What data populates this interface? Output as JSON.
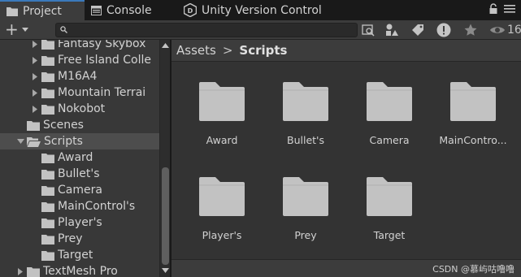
{
  "tabs": [
    {
      "label": "Project",
      "icon": "folder-icon",
      "active": true
    },
    {
      "label": "Console",
      "icon": "console-icon",
      "active": false
    },
    {
      "label": "Unity Version Control",
      "icon": "unity-vc-icon",
      "active": false
    }
  ],
  "toolbar": {
    "create_label": "+",
    "search_value": "",
    "hidden_count": "16"
  },
  "tree": [
    {
      "label": "Fantasy Skybox",
      "depth": 2,
      "expandable": true
    },
    {
      "label": "Free Island Colle",
      "depth": 2,
      "expandable": true
    },
    {
      "label": "M16A4",
      "depth": 2,
      "expandable": true
    },
    {
      "label": "Mountain Terrai",
      "depth": 2,
      "expandable": true
    },
    {
      "label": "Nokobot",
      "depth": 2,
      "expandable": true
    },
    {
      "label": "Scenes",
      "depth": 1,
      "expandable": false
    },
    {
      "label": "Scripts",
      "depth": 1,
      "expandable": true,
      "expanded": true,
      "selected": true
    },
    {
      "label": "Award",
      "depth": 2,
      "expandable": false
    },
    {
      "label": "Bullet's",
      "depth": 2,
      "expandable": false
    },
    {
      "label": "Camera",
      "depth": 2,
      "expandable": false
    },
    {
      "label": "MainControl's",
      "depth": 2,
      "expandable": false
    },
    {
      "label": "Player's",
      "depth": 2,
      "expandable": false
    },
    {
      "label": "Prey",
      "depth": 2,
      "expandable": false
    },
    {
      "label": "Target",
      "depth": 2,
      "expandable": false
    },
    {
      "label": "TextMesh Pro",
      "depth": 1,
      "expandable": true
    }
  ],
  "breadcrumb": {
    "root": "Assets",
    "separator": ">",
    "current": "Scripts"
  },
  "grid": [
    {
      "label": "Award"
    },
    {
      "label": "Bullet's"
    },
    {
      "label": "Camera"
    },
    {
      "label": "MainContro..."
    },
    {
      "label": "Player's"
    },
    {
      "label": "Prey"
    },
    {
      "label": "Target"
    }
  ],
  "watermark": "CSDN @慕屿咕噜噜",
  "colors": {
    "accent": "#3a79bb",
    "folder": "#c2c2c2",
    "selected_row": "#4d4d4d"
  }
}
